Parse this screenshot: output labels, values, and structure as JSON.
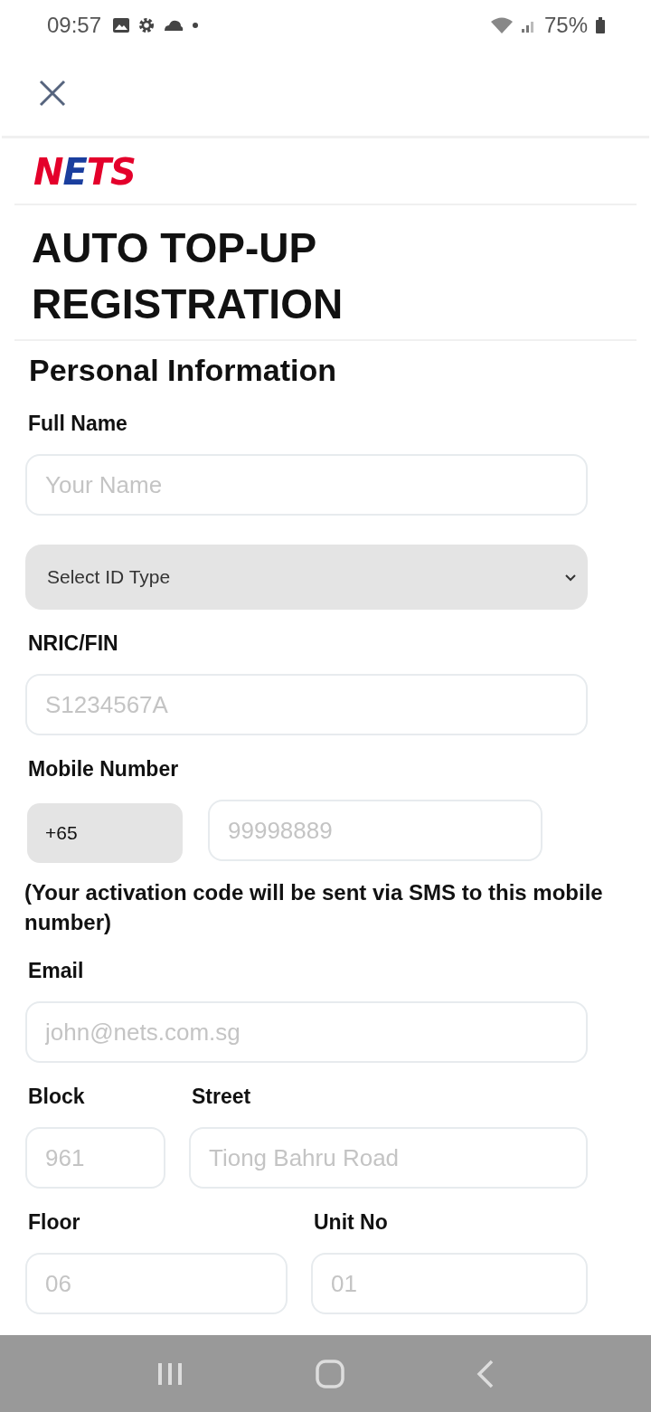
{
  "status_bar": {
    "time": "09:57",
    "battery": "75%"
  },
  "logo": [
    {
      "text": "N",
      "color": "#e4002b"
    },
    {
      "text": "E",
      "color": "#1a3e9e"
    },
    {
      "text": "TS",
      "color": "#e4002b"
    }
  ],
  "title": "AUTO TOP-UP REGISTRATION",
  "section": "Personal Information",
  "rows": [
    {
      "items": [
        {
          "kind": "text",
          "label": "Full Name",
          "placeholder": "Your Name"
        }
      ]
    },
    {
      "items": [
        {
          "kind": "select",
          "value": "Select ID Type"
        }
      ]
    },
    {
      "items": [
        {
          "kind": "text",
          "label": "NRIC/FIN",
          "placeholder": "S1234567A"
        }
      ]
    },
    {
      "items": [
        {
          "kind": "phone",
          "label": "Mobile Number",
          "prefix": "+65",
          "placeholder": "99998889",
          "note": "(Your activation code will be sent via SMS to this mobile number)"
        }
      ]
    },
    {
      "items": [
        {
          "kind": "text",
          "label": "Email",
          "placeholder": "john@nets.com.sg"
        }
      ]
    },
    {
      "items": [
        {
          "kind": "text",
          "label": "Block",
          "placeholder": "961"
        },
        {
          "kind": "text",
          "label": "Street",
          "placeholder": "Tiong Bahru Road"
        }
      ]
    },
    {
      "items": [
        {
          "kind": "text",
          "label": "Floor",
          "placeholder": "06"
        },
        {
          "kind": "text",
          "label": "Unit No",
          "placeholder": "01"
        }
      ]
    }
  ]
}
